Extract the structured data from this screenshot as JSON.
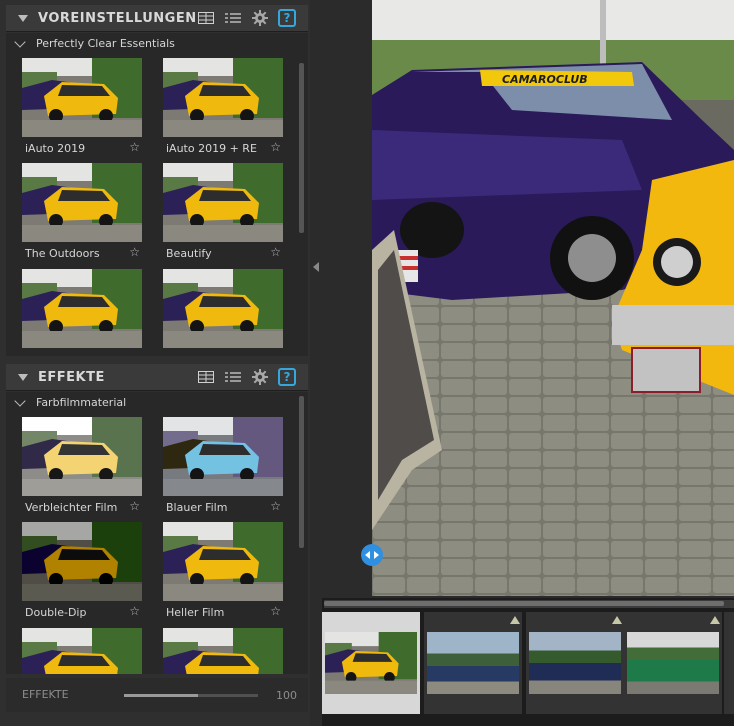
{
  "presets_panel": {
    "title": "VOREINSTELLUNGEN",
    "group": "Perfectly Clear Essentials",
    "items": [
      {
        "label": "iAuto 2019"
      },
      {
        "label": "iAuto 2019 + RE"
      },
      {
        "label": "The Outdoors"
      },
      {
        "label": "Beautify"
      },
      {
        "label": ""
      },
      {
        "label": ""
      }
    ],
    "icons": [
      "grid-view-icon",
      "list-view-icon",
      "gear-icon",
      "help-icon"
    ]
  },
  "effects_panel": {
    "title": "EFFEKTE",
    "group": "Farbfilmmaterial",
    "items": [
      {
        "label": "Verbleichter Film"
      },
      {
        "label": "Blauer Film"
      },
      {
        "label": "Double-Dip"
      },
      {
        "label": "Heller Film"
      },
      {
        "label": ""
      },
      {
        "label": ""
      }
    ],
    "icons": [
      "grid-view-icon",
      "list-view-icon",
      "gear-icon",
      "help-icon"
    ]
  },
  "effects_strength": {
    "label": "EFFEKTE",
    "value": "100",
    "fraction": 0.55
  },
  "help_glyph": "?",
  "star_glyph": "☆",
  "main_image": {
    "windshield_banner": "CAMAROCLUB"
  },
  "filmstrip": {
    "selected_index": 0,
    "frames": [
      "yellow-camaro",
      "blue-mustang",
      "dark-blue-camaro",
      "green-vw-bus",
      "partial"
    ]
  },
  "colors": {
    "accent": "#35a7dc",
    "compare_handle": "#2f8fe0",
    "panel_header": "#3a3a3a",
    "panel_body": "#282828"
  }
}
